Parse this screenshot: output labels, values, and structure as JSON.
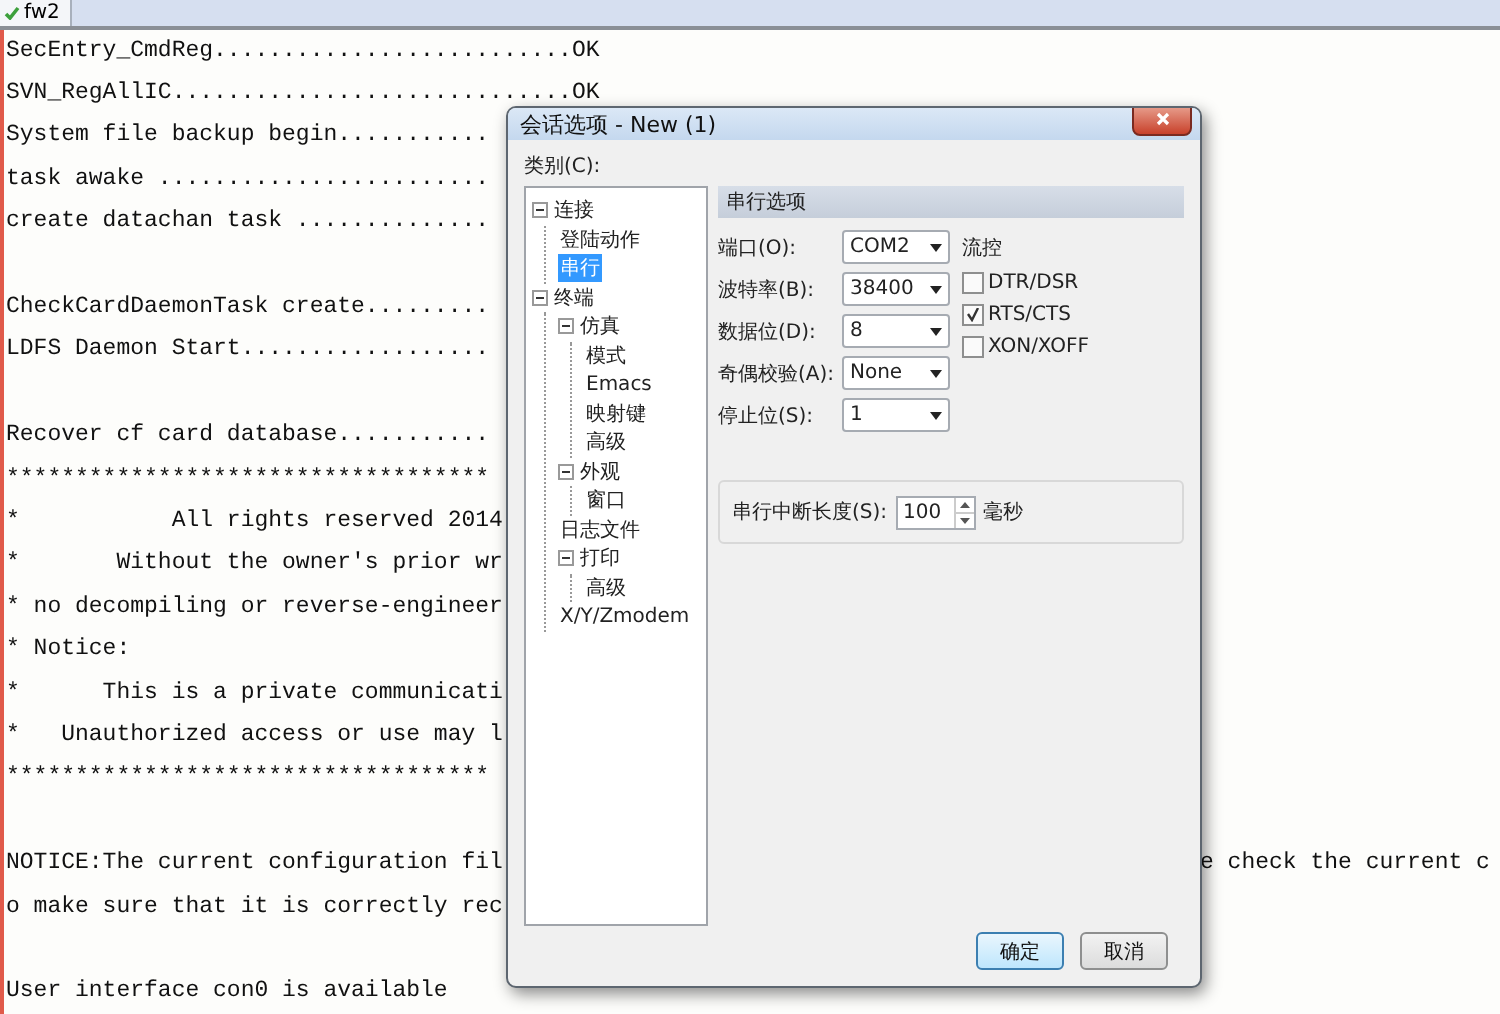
{
  "tab": {
    "label": "fw2"
  },
  "terminal": {
    "lines": [
      {
        "kind": "text",
        "text": "SecEntry_CmdReg..........................OK"
      },
      {
        "kind": "text",
        "text": "SVN_RegAllIC.............................OK"
      },
      {
        "kind": "text",
        "text": "System file backup begin..........."
      },
      {
        "kind": "text",
        "text": "task awake ........................"
      },
      {
        "kind": "text",
        "text": "create datachan task .............."
      },
      {
        "kind": "blank"
      },
      {
        "kind": "text",
        "text": "CheckCardDaemonTask create........."
      },
      {
        "kind": "text",
        "text": "LDFS Daemon Start.................."
      },
      {
        "kind": "blank"
      },
      {
        "kind": "text",
        "text": "Recover cf card database..........."
      },
      {
        "kind": "text",
        "text": "***********************************"
      },
      {
        "kind": "text",
        "text": "*           All rights reserved 2014"
      },
      {
        "kind": "text",
        "text": "*       Without the owner's prior wr"
      },
      {
        "kind": "text",
        "text": "* no decompiling or reverse-engineer"
      },
      {
        "kind": "text",
        "text": "* Notice:"
      },
      {
        "kind": "text",
        "text": "*      This is a private communicati"
      },
      {
        "kind": "text",
        "text": "*   Unauthorized access or use may l"
      },
      {
        "kind": "text",
        "text": "***********************************"
      },
      {
        "kind": "blank"
      },
      {
        "kind": "text",
        "text": "NOTICE:The current configuration fil",
        "continuation": "e check the current c"
      },
      {
        "kind": "text",
        "text": "o make sure that it is correctly rec"
      },
      {
        "kind": "blank"
      },
      {
        "kind": "text",
        "text": "User interface con0 is available"
      }
    ]
  },
  "dialog": {
    "title": "会话选项 - New (1)",
    "category_label": "类别(C):",
    "tree": [
      {
        "label": "连接",
        "selected": false,
        "expanded": true,
        "children": [
          {
            "label": "登陆动作",
            "selected": false
          },
          {
            "label": "串行",
            "selected": true
          }
        ]
      },
      {
        "label": "终端",
        "selected": false,
        "expanded": true,
        "children": [
          {
            "label": "仿真",
            "selected": false,
            "expanded": true,
            "children": [
              {
                "label": "模式",
                "selected": false
              },
              {
                "label": "Emacs",
                "selected": false
              },
              {
                "label": "映射键",
                "selected": false
              },
              {
                "label": "高级",
                "selected": false
              }
            ]
          },
          {
            "label": "外观",
            "selected": false,
            "expanded": true,
            "children": [
              {
                "label": "窗口",
                "selected": false
              }
            ]
          },
          {
            "label": "日志文件",
            "selected": false
          },
          {
            "label": "打印",
            "selected": false,
            "expanded": true,
            "children": [
              {
                "label": "高级",
                "selected": false
              }
            ]
          },
          {
            "label": "X/Y/Zmodem",
            "selected": false
          }
        ]
      }
    ],
    "section_title": "串行选项",
    "fields": [
      {
        "label": "端口(O):",
        "value": "COM2"
      },
      {
        "label": "波特率(B):",
        "value": "38400"
      },
      {
        "label": "数据位(D):",
        "value": "8"
      },
      {
        "label": "奇偶校验(A):",
        "value": "None"
      },
      {
        "label": "停止位(S):",
        "value": "1"
      }
    ],
    "flow_control": {
      "label": "流控",
      "options": [
        {
          "label": "DTR/DSR",
          "checked": false
        },
        {
          "label": "RTS/CTS",
          "checked": true
        },
        {
          "label": "XON/XOFF",
          "checked": false
        }
      ]
    },
    "break_length": {
      "label": "串行中断长度(S):",
      "value": "100",
      "unit": "毫秒"
    },
    "buttons": [
      {
        "label": "确定",
        "default": true
      },
      {
        "label": "取消",
        "default": false
      }
    ]
  }
}
